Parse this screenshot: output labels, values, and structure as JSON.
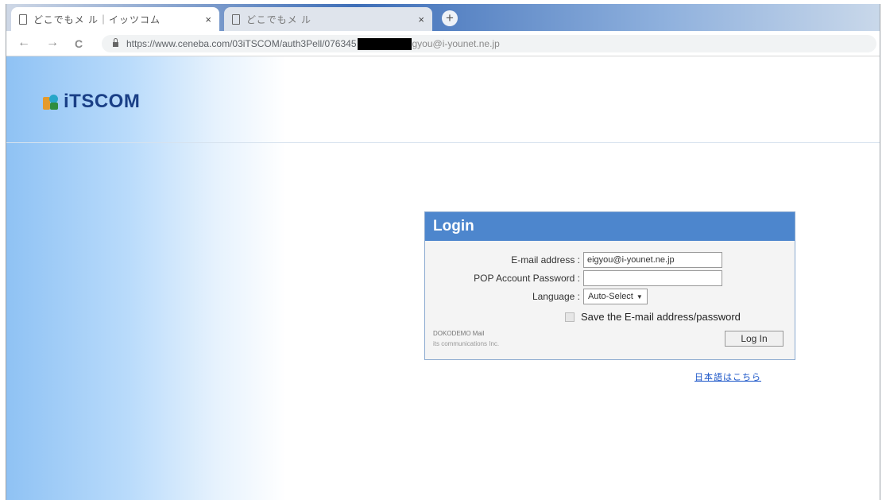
{
  "browser": {
    "tabs": [
      {
        "title": "どこでもメ ル｜イッツコム",
        "close": "×"
      },
      {
        "title": "どこでもメ ル",
        "close": "×"
      }
    ],
    "new_tab": "+",
    "nav": {
      "back": "←",
      "forward": "→",
      "reload": "C"
    },
    "url_prefix": "https://www.ceneba.com/03iTSCOM/auth3Pell/076345",
    "url_suffix": "gyou@i-younet.ne.jp"
  },
  "brand": {
    "name": "iTSCOM"
  },
  "login": {
    "title": "Login",
    "email_label": "E-mail address :",
    "email_value": "eigyou@i-younet.ne.jp",
    "password_label": "POP Account Password :",
    "password_value": "",
    "language_label": "Language :",
    "language_value": "Auto-Select",
    "save_label": "Save the E-mail address/password",
    "footer_line1": "DOKODEMO Mail",
    "footer_line2": "its communications Inc.",
    "button_label": "Log In"
  },
  "japanese_link": "日本語はこちら"
}
